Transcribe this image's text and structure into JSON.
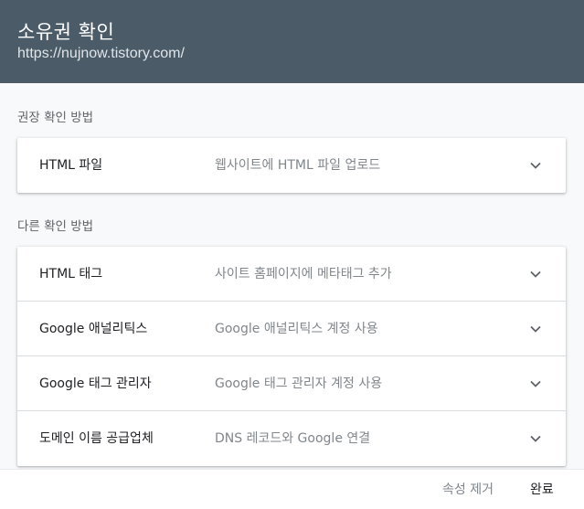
{
  "header": {
    "title": "소유권 확인",
    "url": "https://nujnow.tistory.com/"
  },
  "recommended": {
    "label": "권장 확인 방법",
    "methods": [
      {
        "name": "HTML 파일",
        "description": "웹사이트에 HTML 파일 업로드",
        "icon": "chevron-down-icon"
      }
    ]
  },
  "other": {
    "label": "다른 확인 방법",
    "methods": [
      {
        "name": "HTML 태그",
        "description": "사이트 홈페이지에 메타태그 추가",
        "icon": "chevron-down-icon"
      },
      {
        "name": "Google 애널리틱스",
        "description": "Google 애널리틱스 계정 사용",
        "icon": "chevron-down-icon"
      },
      {
        "name": "Google 태그 관리자",
        "description": "Google 태그 관리자 계정 사용",
        "icon": "chevron-down-icon"
      },
      {
        "name": "도메인 이름 공급업체",
        "description": "DNS 레코드와 Google 연결",
        "icon": "chevron-down-icon"
      }
    ]
  },
  "footer": {
    "remove_label": "속성 제거",
    "done_label": "완료"
  },
  "colors": {
    "header_bg": "#4b5c68",
    "page_bg": "#f8f9fa"
  }
}
